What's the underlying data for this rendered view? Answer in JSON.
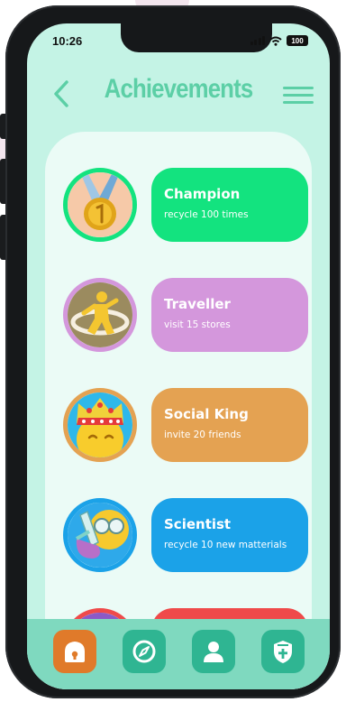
{
  "status_bar": {
    "time": "10:26",
    "battery": "100"
  },
  "header": {
    "title": "Achievements"
  },
  "achievements": [
    {
      "title": "Champion",
      "subtitle": "recycle 100 times",
      "color": "#13e37f",
      "ring": "#13e37f",
      "icon": "medal-icon"
    },
    {
      "title": "Traveller",
      "subtitle": "visit 15 stores",
      "color": "#d497dc",
      "ring": "#d497dc",
      "icon": "traveller-icon"
    },
    {
      "title": "Social King",
      "subtitle": "invite 20 friends",
      "color": "#e4a252",
      "ring": "#e4a252",
      "icon": "crown-icon"
    },
    {
      "title": "Scientist",
      "subtitle": "recycle 10 new matterials",
      "color": "#1ba2e8",
      "ring": "#1ba2e8",
      "icon": "science-icon"
    },
    {
      "title": "",
      "subtitle": "",
      "color": "#ef4a4a",
      "ring": "#ef4a4a",
      "icon": ""
    }
  ],
  "bottom_nav": [
    {
      "name": "home-icon",
      "active": true
    },
    {
      "name": "compass-icon",
      "active": false
    },
    {
      "name": "profile-icon",
      "active": false
    },
    {
      "name": "shield-icon",
      "active": false
    }
  ],
  "colors": {
    "accent": "#5ccfa6",
    "screen_bg": "#c4f3e5",
    "nav_bg": "#7fd9bf",
    "nav_button": "#2fb592",
    "nav_active": "#e07a2a"
  }
}
